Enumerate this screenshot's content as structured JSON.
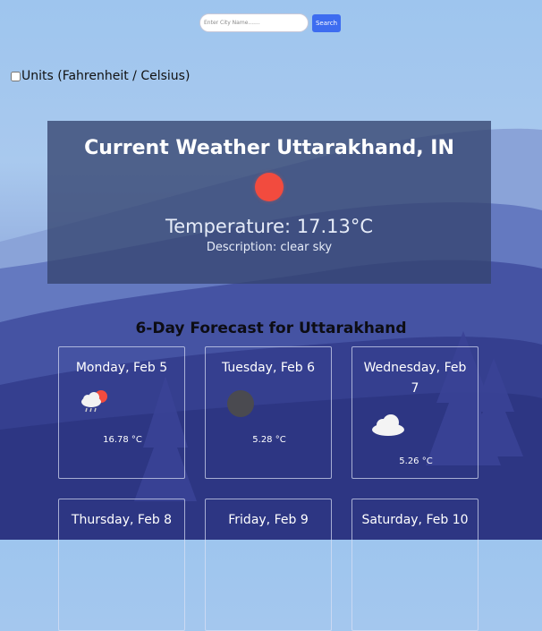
{
  "search": {
    "placeholder": "Enter City Name.......",
    "value": "",
    "button_label": "Search"
  },
  "units": {
    "label": "Units (Fahrenheit / Celsius)",
    "checked": false
  },
  "current": {
    "title": "Current Weather Uttarakhand, IN",
    "icon": "clear-sky-sun-icon",
    "temperature": "Temperature: 17.13°C",
    "description": "Description: clear sky"
  },
  "forecast": {
    "title": "6-Day Forecast for Uttarakhand",
    "days": [
      {
        "day": "Monday, Feb 5",
        "icon": "partly-cloudy-rain-icon",
        "temp": "16.78 °C"
      },
      {
        "day": "Tuesday, Feb 6",
        "icon": "dark-moon-icon",
        "temp": "5.28 °C"
      },
      {
        "day": "Wednesday, Feb 7",
        "icon": "cloud-icon",
        "temp": "5.26 °C"
      },
      {
        "day": "Thursday, Feb 8"
      },
      {
        "day": "Friday, Feb 9"
      },
      {
        "day": "Saturday, Feb 10"
      }
    ]
  },
  "colors": {
    "accent": "#3d6cf0",
    "sun": "#f24b3e",
    "card": "#344470"
  }
}
